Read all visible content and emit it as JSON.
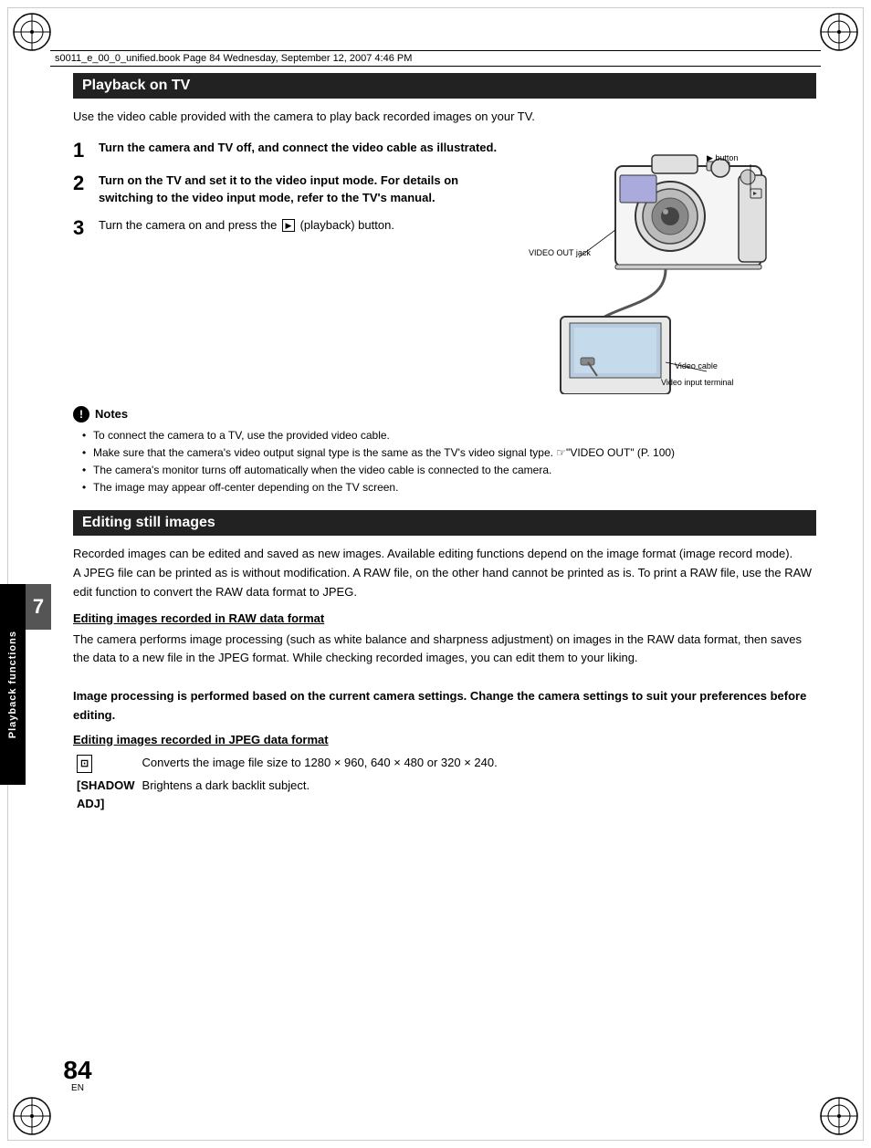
{
  "header": {
    "file_info": "s0011_e_00_0_unified.book  Page 84  Wednesday, September 12, 2007  4:46 PM"
  },
  "page_number": "84",
  "page_number_sub": "EN",
  "chapter_number": "7",
  "side_tab_label": "Playback functions",
  "playback_section": {
    "title": "Playback on TV",
    "intro": "Use the video cable provided with the camera to play back recorded images on your TV.",
    "steps": [
      {
        "number": "1",
        "text_bold": "Turn the camera and TV off, and connect the video cable as illustrated."
      },
      {
        "number": "2",
        "text_bold": "Turn on the TV and set it to the video input mode. For details on switching to the video input mode, refer to the TV's manual."
      },
      {
        "number": "3",
        "text_start": "Turn the camera on and press the ",
        "icon": "▶",
        "text_end": " (playback) button."
      }
    ],
    "camera_labels": {
      "button_label": "▶ button",
      "video_out_label": "VIDEO OUT jack",
      "video_cable_label": "Video cable",
      "video_input_label": "Video input terminal"
    },
    "notes": {
      "header": "Notes",
      "items": [
        "To connect the camera to a TV, use the provided video cable.",
        "Make sure that the camera's video output signal type is the same as the TV's video signal type. ☞\"VIDEO OUT\" (P. 100)",
        "The camera's monitor turns off automatically when the video cable is connected to the camera.",
        "The image may appear off-center depending on the TV screen."
      ]
    }
  },
  "editing_section": {
    "title": "Editing still images",
    "intro_lines": [
      "Recorded images can be edited and saved as new images. Available editing functions depend on the image format (image record mode).",
      "A JPEG file can be printed as is without modification. A RAW file, on the other hand cannot be printed as is. To print a RAW file, use the RAW edit function to convert the RAW data format to JPEG."
    ],
    "raw_subsection": {
      "title": "Editing images recorded in RAW data format",
      "body": "The camera performs image processing (such as white balance and sharpness adjustment) on images in the RAW data format, then saves the data to a new file in the JPEG format. While checking recorded images, you can edit them to your liking.",
      "bold_note": "Image processing is performed based on the current camera settings. Change the camera settings to suit your preferences before editing."
    },
    "jpeg_subsection": {
      "title": "Editing images recorded in JPEG data format",
      "icon_label": "⊡",
      "icon_description": "Converts the image file size to 1280 × 960, 640 × 480 or 320 × 240.",
      "shadow_adj_label": "[SHADOW ADJ]",
      "shadow_adj_description": "Brightens a dark backlit subject."
    }
  }
}
